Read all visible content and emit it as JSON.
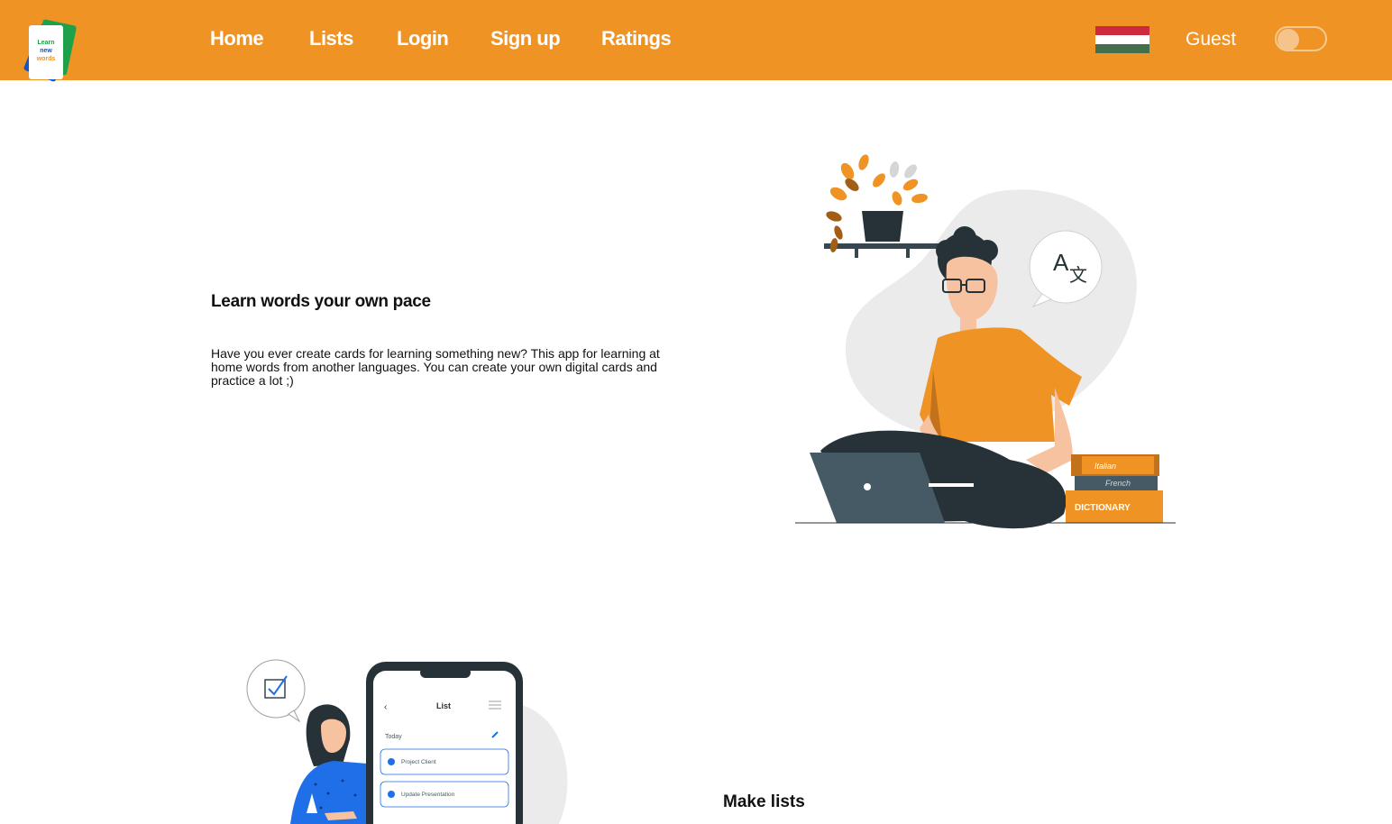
{
  "app": {
    "logo_text": [
      "Learn",
      "new",
      "words"
    ]
  },
  "nav": {
    "links": [
      {
        "label": "Home"
      },
      {
        "label": "Lists"
      },
      {
        "label": "Login"
      },
      {
        "label": "Sign up"
      },
      {
        "label": "Ratings"
      }
    ],
    "flag": "hungary-flag",
    "user_label": "Guest",
    "theme_toggle_on": false
  },
  "hero": {
    "title": "Learn words your own pace",
    "description": "Have you ever create cards for learning something new? This app for learning at home words from another languages. You can create your own digital cards and practice a lot ;)"
  },
  "illustration1": {
    "bubble_glyph_a": "A",
    "bubble_glyph_b": "文",
    "books": [
      "Italian",
      "French",
      "DICTIONARY"
    ]
  },
  "illustration2": {
    "phone_title": "List",
    "phone_section": "Today",
    "phone_items": [
      "Project Client",
      "Update Presentation"
    ]
  },
  "section2": {
    "title": "Make lists"
  },
  "colors": {
    "brand": "#f09325",
    "text": "#111111"
  }
}
